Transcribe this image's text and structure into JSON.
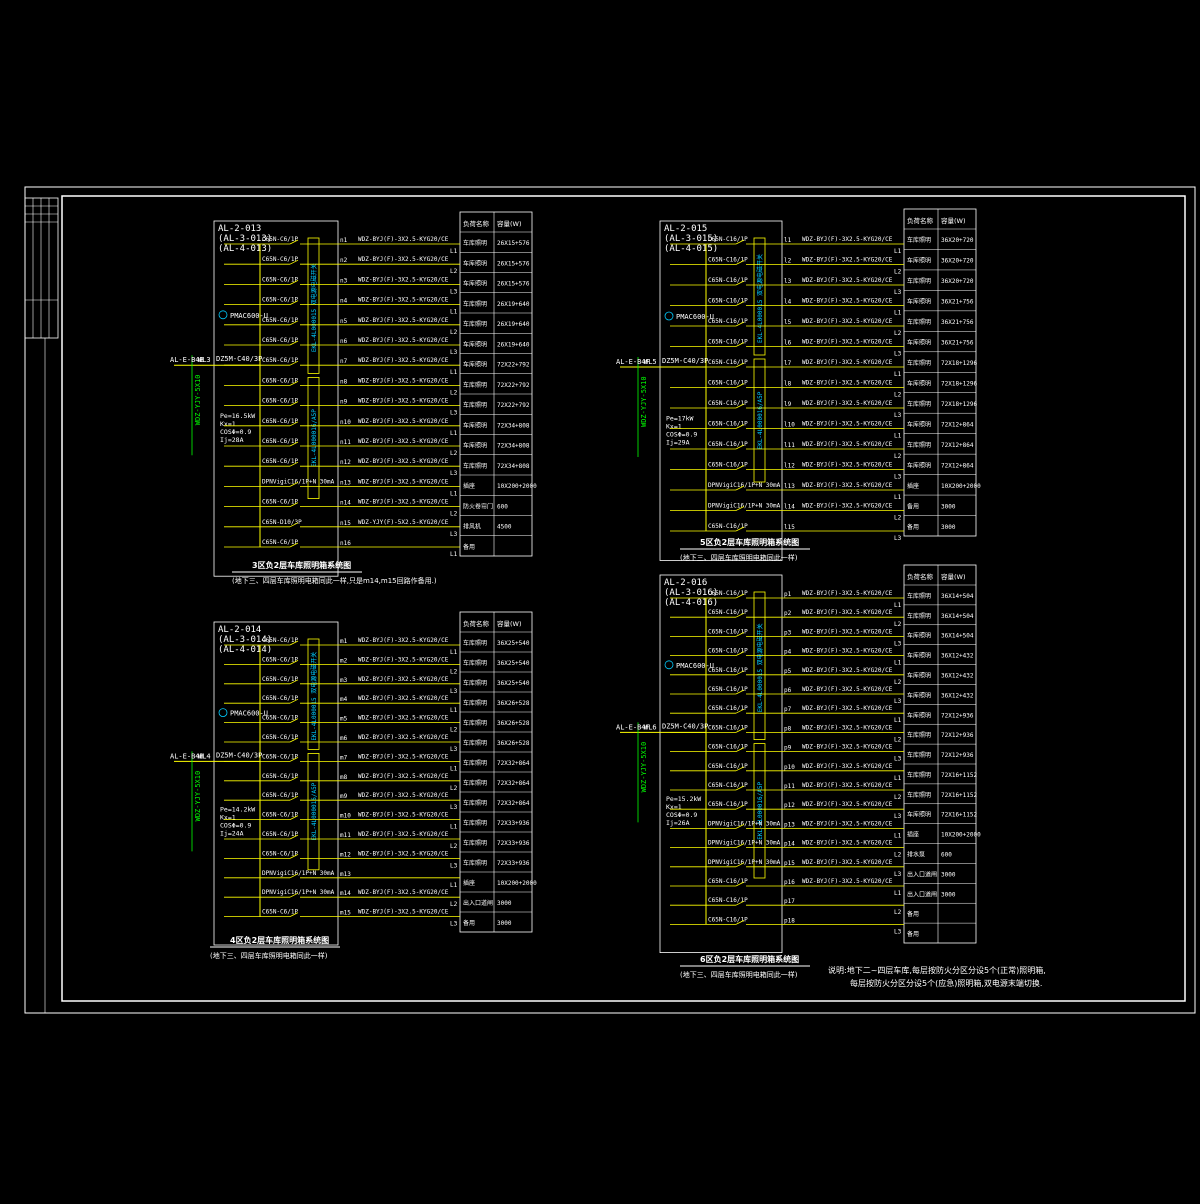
{
  "colors": {
    "background": "#000000",
    "frame": "#ffffff",
    "wire": "#ffff00",
    "label": "#ffffff",
    "accent_cyan": "#00ccff",
    "green": "#00ff00",
    "title_block_text": "#ffff00"
  },
  "title_block": {
    "rows": [
      "",
      "",
      "",
      "",
      "",
      "",
      ""
    ]
  },
  "table_headers": {
    "name": "负荷名称",
    "capacity": "容量(W)"
  },
  "panels": [
    {
      "id": "AL-2-013",
      "aliases": [
        "(AL-3-013)",
        "(AL-4-013)"
      ],
      "incoming_source": "AL-E-B4B",
      "incoming_no": "WL3",
      "incoming_breaker": "DZ5M-C40/3P",
      "incoming_cable": "WDZ-YJY-5X10",
      "meter": "PMAC600-U",
      "calc": [
        "Pe=16.5kW",
        "Kx=1",
        "COSΦ=0.9",
        "Ij=28A"
      ],
      "bus_label_top": "EKL-4L000015 双电源电磁开关",
      "bus_label_bottom": "EKL-4L000016/A5P",
      "caption": "3区负2层车库照明箱系统图",
      "subcaption": "(地下三、四层车库照明电箱同此一样,只是m14,m15回路作备用.)",
      "circuits": [
        {
          "breaker": "C65N-C6/1P",
          "no": "n1",
          "cable": "WDZ-BYJ(F)-3X2.5-KYG20/CE",
          "phase": "L1",
          "name": "车库照明",
          "cap": "26X15+576"
        },
        {
          "breaker": "C65N-C6/1P",
          "no": "n2",
          "cable": "WDZ-BYJ(F)-3X2.5-KYG20/CE",
          "phase": "L2",
          "name": "车库照明",
          "cap": "26X15+576"
        },
        {
          "breaker": "C65N-C6/1P",
          "no": "n3",
          "cable": "WDZ-BYJ(F)-3X2.5-KYG20/CE",
          "phase": "L3",
          "name": "车库照明",
          "cap": "26X15+576"
        },
        {
          "breaker": "C65N-C6/1P",
          "no": "n4",
          "cable": "WDZ-BYJ(F)-3X2.5-KYG20/CE",
          "phase": "L1",
          "name": "车库照明",
          "cap": "26X19+640"
        },
        {
          "breaker": "C65N-C6/1P",
          "no": "n5",
          "cable": "WDZ-BYJ(F)-3X2.5-KYG20/CE",
          "phase": "L2",
          "name": "车库照明",
          "cap": "26X19+640"
        },
        {
          "breaker": "C65N-C6/1P",
          "no": "n6",
          "cable": "WDZ-BYJ(F)-3X2.5-KYG20/CE",
          "phase": "L3",
          "name": "车库照明",
          "cap": "26X19+640"
        },
        {
          "breaker": "C65N-C6/1P",
          "no": "n7",
          "cable": "WDZ-BYJ(F)-3X2.5-KYG20/CE",
          "phase": "L1",
          "name": "车库照明",
          "cap": "72X22+792"
        },
        {
          "breaker": "C65N-C6/1P",
          "no": "n8",
          "cable": "WDZ-BYJ(F)-3X2.5-KYG20/CE",
          "phase": "L2",
          "name": "车库照明",
          "cap": "72X22+792"
        },
        {
          "breaker": "C65N-C6/1P",
          "no": "n9",
          "cable": "WDZ-BYJ(F)-3X2.5-KYG20/CE",
          "phase": "L3",
          "name": "车库照明",
          "cap": "72X22+792"
        },
        {
          "breaker": "C65N-C6/1P",
          "no": "n10",
          "cable": "WDZ-BYJ(F)-3X2.5-KYG20/CE",
          "phase": "L1",
          "name": "车库照明",
          "cap": "72X34+808"
        },
        {
          "breaker": "C65N-C6/1P",
          "no": "n11",
          "cable": "WDZ-BYJ(F)-3X2.5-KYG20/CE",
          "phase": "L2",
          "name": "车库照明",
          "cap": "72X34+808"
        },
        {
          "breaker": "C65N-C6/1P",
          "no": "n12",
          "cable": "WDZ-BYJ(F)-3X2.5-KYG20/CE",
          "phase": "L3",
          "name": "车库照明",
          "cap": "72X34+808"
        },
        {
          "breaker": "DPNVigiC16/1P+N 30mA",
          "no": "n13",
          "cable": "WDZ-BYJ(F)-3X2.5-KYG20/CE",
          "phase": "L1",
          "name": "插座",
          "cap": "10X200+2000"
        },
        {
          "breaker": "C65N-C6/1P",
          "no": "n14",
          "cable": "WDZ-BYJ(F)-3X2.5-KYG20/CE",
          "phase": "L2",
          "name": "防火卷帘门",
          "cap": "600"
        },
        {
          "breaker": "C65N-D10/3P",
          "no": "n15",
          "cable": "WDZ-YJY(F)-5X2.5-KYG20/CE",
          "phase": "L3",
          "name": "排风机",
          "cap": "4500"
        },
        {
          "breaker": "C65N-C6/1P",
          "no": "n16",
          "cable": "",
          "phase": "L1",
          "name": "备用",
          "cap": ""
        }
      ]
    },
    {
      "id": "AL-2-014",
      "aliases": [
        "(AL-3-014)",
        "(AL-4-014)"
      ],
      "incoming_source": "AL-E-B4B",
      "incoming_no": "WL4",
      "incoming_breaker": "DZ5M-C40/3P",
      "incoming_cable": "WDZ-YJY-5X10",
      "meter": "PMAC600-U",
      "calc": [
        "Pe=14.2kW",
        "Kx=1",
        "COSΦ=0.9",
        "Ij=24A"
      ],
      "bus_label_top": "EKL-4L000015 双电源电磁开关",
      "bus_label_bottom": "EKL-4L000016/A5P",
      "caption": "4区负2层车库照明箱系统图",
      "subcaption": "(地下三、四层车库照明电箱同此一样)",
      "circuits": [
        {
          "breaker": "C65N-C6/1P",
          "no": "m1",
          "cable": "WDZ-BYJ(F)-3X2.5-KYG20/CE",
          "phase": "L1",
          "name": "车库照明",
          "cap": "36X25+540"
        },
        {
          "breaker": "C65N-C6/1P",
          "no": "m2",
          "cable": "WDZ-BYJ(F)-3X2.5-KYG20/CE",
          "phase": "L2",
          "name": "车库照明",
          "cap": "36X25+540"
        },
        {
          "breaker": "C65N-C6/1P",
          "no": "m3",
          "cable": "WDZ-BYJ(F)-3X2.5-KYG20/CE",
          "phase": "L3",
          "name": "车库照明",
          "cap": "36X25+540"
        },
        {
          "breaker": "C65N-C6/1P",
          "no": "m4",
          "cable": "WDZ-BYJ(F)-3X2.5-KYG20/CE",
          "phase": "L1",
          "name": "车库照明",
          "cap": "36X26+528"
        },
        {
          "breaker": "C65N-C6/1P",
          "no": "m5",
          "cable": "WDZ-BYJ(F)-3X2.5-KYG20/CE",
          "phase": "L2",
          "name": "车库照明",
          "cap": "36X26+528"
        },
        {
          "breaker": "C65N-C6/1P",
          "no": "m6",
          "cable": "WDZ-BYJ(F)-3X2.5-KYG20/CE",
          "phase": "L3",
          "name": "车库照明",
          "cap": "36X26+528"
        },
        {
          "breaker": "C65N-C6/1P",
          "no": "m7",
          "cable": "WDZ-BYJ(F)-3X2.5-KYG20/CE",
          "phase": "L1",
          "name": "车库照明",
          "cap": "72X32+864"
        },
        {
          "breaker": "C65N-C6/1P",
          "no": "m8",
          "cable": "WDZ-BYJ(F)-3X2.5-KYG20/CE",
          "phase": "L2",
          "name": "车库照明",
          "cap": "72X32+864"
        },
        {
          "breaker": "C65N-C6/1P",
          "no": "m9",
          "cable": "WDZ-BYJ(F)-3X2.5-KYG20/CE",
          "phase": "L3",
          "name": "车库照明",
          "cap": "72X32+864"
        },
        {
          "breaker": "C65N-C6/1P",
          "no": "m10",
          "cable": "WDZ-BYJ(F)-3X2.5-KYG20/CE",
          "phase": "L1",
          "name": "车库照明",
          "cap": "72X33+936"
        },
        {
          "breaker": "C65N-C6/1P",
          "no": "m11",
          "cable": "WDZ-BYJ(F)-3X2.5-KYG20/CE",
          "phase": "L2",
          "name": "车库照明",
          "cap": "72X33+936"
        },
        {
          "breaker": "C65N-C6/1P",
          "no": "m12",
          "cable": "WDZ-BYJ(F)-3X2.5-KYG20/CE",
          "phase": "L3",
          "name": "车库照明",
          "cap": "72X33+936"
        },
        {
          "breaker": "DPNVigiC16/1P+N 30mA",
          "no": "m13",
          "cable": "",
          "phase": "L1",
          "name": "插座",
          "cap": "10X200+2000"
        },
        {
          "breaker": "DPNVigiC16/1P+N 30mA",
          "no": "m14",
          "cable": "WDZ-BYJ(F)-3X2.5-KYG20/CE",
          "phase": "L2",
          "name": "出入口道闸",
          "cap": "3000"
        },
        {
          "breaker": "C65N-C6/1P",
          "no": "m15",
          "cable": "WDZ-BYJ(F)-3X2.5-KYG20/CE",
          "phase": "L3",
          "name": "备用",
          "cap": "3000"
        }
      ]
    },
    {
      "id": "AL-2-015",
      "aliases": [
        "(AL-3-015)",
        "(AL-4-015)"
      ],
      "incoming_source": "AL-E-B4F",
      "incoming_no": "WL5",
      "incoming_breaker": "DZ5M-C40/3P",
      "incoming_cable": "WDZ-YJY-5X10",
      "meter": "PMAC600-U",
      "calc": [
        "Pe=17kW",
        "Kx=1",
        "COSΦ=0.9",
        "Ij=29A"
      ],
      "bus_label_top": "EKL-4L000015 双电源电磁开关",
      "bus_label_bottom": "EKL-4L000016/A5P",
      "caption": "5区负2层车库照明箱系统图",
      "subcaption": "(地下三、四层车库照明电箱同此一样)",
      "circuits": [
        {
          "breaker": "C65N-C16/1P",
          "no": "l1",
          "cable": "WDZ-BYJ(F)-3X2.5-KYG20/CE",
          "phase": "L1",
          "name": "车库照明",
          "cap": "36X20+720"
        },
        {
          "breaker": "C65N-C16/1P",
          "no": "l2",
          "cable": "WDZ-BYJ(F)-3X2.5-KYG20/CE",
          "phase": "L2",
          "name": "车库照明",
          "cap": "36X20+720"
        },
        {
          "breaker": "C65N-C16/1P",
          "no": "l3",
          "cable": "WDZ-BYJ(F)-3X2.5-KYG20/CE",
          "phase": "L3",
          "name": "车库照明",
          "cap": "36X20+720"
        },
        {
          "breaker": "C65N-C16/1P",
          "no": "l4",
          "cable": "WDZ-BYJ(F)-3X2.5-KYG20/CE",
          "phase": "L1",
          "name": "车库照明",
          "cap": "36X21+756"
        },
        {
          "breaker": "C65N-C16/1P",
          "no": "l5",
          "cable": "WDZ-BYJ(F)-3X2.5-KYG20/CE",
          "phase": "L2",
          "name": "车库照明",
          "cap": "36X21+756"
        },
        {
          "breaker": "C65N-C16/1P",
          "no": "l6",
          "cable": "WDZ-BYJ(F)-3X2.5-KYG20/CE",
          "phase": "L3",
          "name": "车库照明",
          "cap": "36X21+756"
        },
        {
          "breaker": "C65N-C16/1P",
          "no": "l7",
          "cable": "WDZ-BYJ(F)-3X2.5-KYG20/CE",
          "phase": "L1",
          "name": "车库照明",
          "cap": "72X18+1296"
        },
        {
          "breaker": "C65N-C16/1P",
          "no": "l8",
          "cable": "WDZ-BYJ(F)-3X2.5-KYG20/CE",
          "phase": "L2",
          "name": "车库照明",
          "cap": "72X18+1296"
        },
        {
          "breaker": "C65N-C16/1P",
          "no": "l9",
          "cable": "WDZ-BYJ(F)-3X2.5-KYG20/CE",
          "phase": "L3",
          "name": "车库照明",
          "cap": "72X18+1296"
        },
        {
          "breaker": "C65N-C16/1P",
          "no": "l10",
          "cable": "WDZ-BYJ(F)-3X2.5-KYG20/CE",
          "phase": "L1",
          "name": "车库照明",
          "cap": "72X12+864"
        },
        {
          "breaker": "C65N-C16/1P",
          "no": "l11",
          "cable": "WDZ-BYJ(F)-3X2.5-KYG20/CE",
          "phase": "L2",
          "name": "车库照明",
          "cap": "72X12+864"
        },
        {
          "breaker": "C65N-C16/1P",
          "no": "l12",
          "cable": "WDZ-BYJ(F)-3X2.5-KYG20/CE",
          "phase": "L3",
          "name": "车库照明",
          "cap": "72X12+864"
        },
        {
          "breaker": "DPNVigiC16/1P+N 30mA",
          "no": "l13",
          "cable": "WDZ-BYJ(F)-3X2.5-KYG20/CE",
          "phase": "L1",
          "name": "插座",
          "cap": "10X200+2000"
        },
        {
          "breaker": "DPNVigiC16/1P+N 30mA",
          "no": "l14",
          "cable": "WDZ-BYJ(F)-3X2.5-KYG20/CE",
          "phase": "L2",
          "name": "备用",
          "cap": "3000"
        },
        {
          "breaker": "C65N-C16/1P",
          "no": "l15",
          "cable": "",
          "phase": "L3",
          "name": "备用",
          "cap": "3000"
        }
      ]
    },
    {
      "id": "AL-2-016",
      "aliases": [
        "(AL-3-016)",
        "(AL-4-016)"
      ],
      "incoming_source": "AL-E-B4F",
      "incoming_no": "WL6",
      "incoming_breaker": "DZ5M-C40/3P",
      "incoming_cable": "WDZ-YJY-5X10",
      "meter": "PMAC600-U",
      "calc": [
        "Pe=15.2kW",
        "Kx=1",
        "COSΦ=0.9",
        "Ij=26A"
      ],
      "bus_label_top": "EKL-4L000015 双电源电磁开关",
      "bus_label_bottom": "EKL-4L000016/A5P",
      "caption": "6区负2层车库照明箱系统图",
      "subcaption": "(地下三、四层车库照明电箱同此一样)",
      "circuits": [
        {
          "breaker": "C65N-C16/1P",
          "no": "p1",
          "cable": "WDZ-BYJ(F)-3X2.5-KYG20/CE",
          "phase": "L1",
          "name": "车库照明",
          "cap": "36X14+504"
        },
        {
          "breaker": "C65N-C16/1P",
          "no": "p2",
          "cable": "WDZ-BYJ(F)-3X2.5-KYG20/CE",
          "phase": "L2",
          "name": "车库照明",
          "cap": "36X14+504"
        },
        {
          "breaker": "C65N-C16/1P",
          "no": "p3",
          "cable": "WDZ-BYJ(F)-3X2.5-KYG20/CE",
          "phase": "L3",
          "name": "车库照明",
          "cap": "36X14+504"
        },
        {
          "breaker": "C65N-C16/1P",
          "no": "p4",
          "cable": "WDZ-BYJ(F)-3X2.5-KYG20/CE",
          "phase": "L1",
          "name": "车库照明",
          "cap": "36X12+432"
        },
        {
          "breaker": "C65N-C16/1P",
          "no": "p5",
          "cable": "WDZ-BYJ(F)-3X2.5-KYG20/CE",
          "phase": "L2",
          "name": "车库照明",
          "cap": "36X12+432"
        },
        {
          "breaker": "C65N-C16/1P",
          "no": "p6",
          "cable": "WDZ-BYJ(F)-3X2.5-KYG20/CE",
          "phase": "L3",
          "name": "车库照明",
          "cap": "36X12+432"
        },
        {
          "breaker": "C65N-C16/1P",
          "no": "p7",
          "cable": "WDZ-BYJ(F)-3X2.5-KYG20/CE",
          "phase": "L1",
          "name": "车库照明",
          "cap": "72X12+936"
        },
        {
          "breaker": "C65N-C16/1P",
          "no": "p8",
          "cable": "WDZ-BYJ(F)-3X2.5-KYG20/CE",
          "phase": "L2",
          "name": "车库照明",
          "cap": "72X12+936"
        },
        {
          "breaker": "C65N-C16/1P",
          "no": "p9",
          "cable": "WDZ-BYJ(F)-3X2.5-KYG20/CE",
          "phase": "L3",
          "name": "车库照明",
          "cap": "72X12+936"
        },
        {
          "breaker": "C65N-C16/1P",
          "no": "p10",
          "cable": "WDZ-BYJ(F)-3X2.5-KYG20/CE",
          "phase": "L1",
          "name": "车库照明",
          "cap": "72X16+1152"
        },
        {
          "breaker": "C65N-C16/1P",
          "no": "p11",
          "cable": "WDZ-BYJ(F)-3X2.5-KYG20/CE",
          "phase": "L2",
          "name": "车库照明",
          "cap": "72X16+1152"
        },
        {
          "breaker": "C65N-C16/1P",
          "no": "p12",
          "cable": "WDZ-BYJ(F)-3X2.5-KYG20/CE",
          "phase": "L3",
          "name": "车库照明",
          "cap": "72X16+1152"
        },
        {
          "breaker": "DPNVigiC16/1P+N 30mA",
          "no": "p13",
          "cable": "WDZ-BYJ(F)-3X2.5-KYG20/CE",
          "phase": "L1",
          "name": "插座",
          "cap": "10X200+2000"
        },
        {
          "breaker": "DPNVigiC16/1P+N 30mA",
          "no": "p14",
          "cable": "WDZ-BYJ(F)-3X2.5-KYG20/CE",
          "phase": "L2",
          "name": "排水泵",
          "cap": "600"
        },
        {
          "breaker": "DPNVigiC16/1P+N 30mA",
          "no": "p15",
          "cable": "WDZ-BYJ(F)-3X2.5-KYG20/CE",
          "phase": "L3",
          "name": "出入口道闸",
          "cap": "3000"
        },
        {
          "breaker": "C65N-C16/1P",
          "no": "p16",
          "cable": "WDZ-BYJ(F)-3X2.5-KYG20/CE",
          "phase": "L1",
          "name": "出入口道闸",
          "cap": "3000"
        },
        {
          "breaker": "C65N-C16/1P",
          "no": "p17",
          "cable": "",
          "phase": "L2",
          "name": "备用",
          "cap": ""
        },
        {
          "breaker": "C65N-C16/1P",
          "no": "p18",
          "cable": "",
          "phase": "L3",
          "name": "备用",
          "cap": ""
        }
      ]
    }
  ],
  "notes": {
    "line1": "说明:地下二~四层车库,每层按防火分区分设5个(正常)照明箱,",
    "line2": "每层按防火分区分设5个(应急)照明箱,双电源末端切换."
  }
}
